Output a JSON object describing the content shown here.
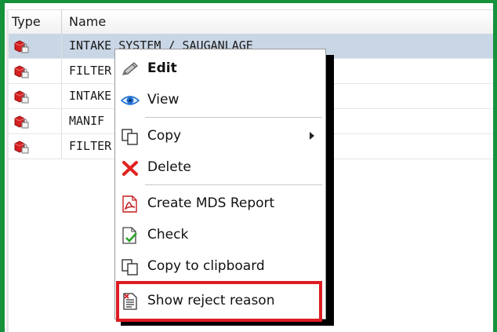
{
  "columns": {
    "type": "Type",
    "name": "Name"
  },
  "rows": [
    {
      "name": "INTAKE SYSTEM / SAUGANLAGE",
      "icon": "red-part-icon",
      "selected": true
    },
    {
      "name": "FILTER",
      "icon": "red-part-icon",
      "selected": false
    },
    {
      "name": "INTAKE",
      "icon": "red-part-icon",
      "selected": false
    },
    {
      "name": "MANIF",
      "icon": "red-part-icon",
      "selected": false
    },
    {
      "name": "FILTER",
      "icon": "red-part-icon",
      "selected": false
    }
  ],
  "context_menu": {
    "items": [
      {
        "label": "Edit",
        "icon": "pencil-icon",
        "bold": true
      },
      {
        "label": "View",
        "icon": "eye-icon"
      },
      {
        "label": "Copy",
        "icon": "copy-icon",
        "submenu": true
      },
      {
        "label": "Delete",
        "icon": "delete-x-icon"
      },
      {
        "label": "Create MDS Report",
        "icon": "pdf-report-icon"
      },
      {
        "label": "Check",
        "icon": "check-document-icon"
      },
      {
        "label": "Copy to clipboard",
        "icon": "clipboard-icon"
      },
      {
        "label": "Show reject reason",
        "icon": "reject-reason-icon",
        "highlighted": true
      }
    ]
  },
  "colors": {
    "frame_border": "#17923c",
    "selection": "#c9d6e6",
    "highlight_box": "#dd1c22"
  }
}
